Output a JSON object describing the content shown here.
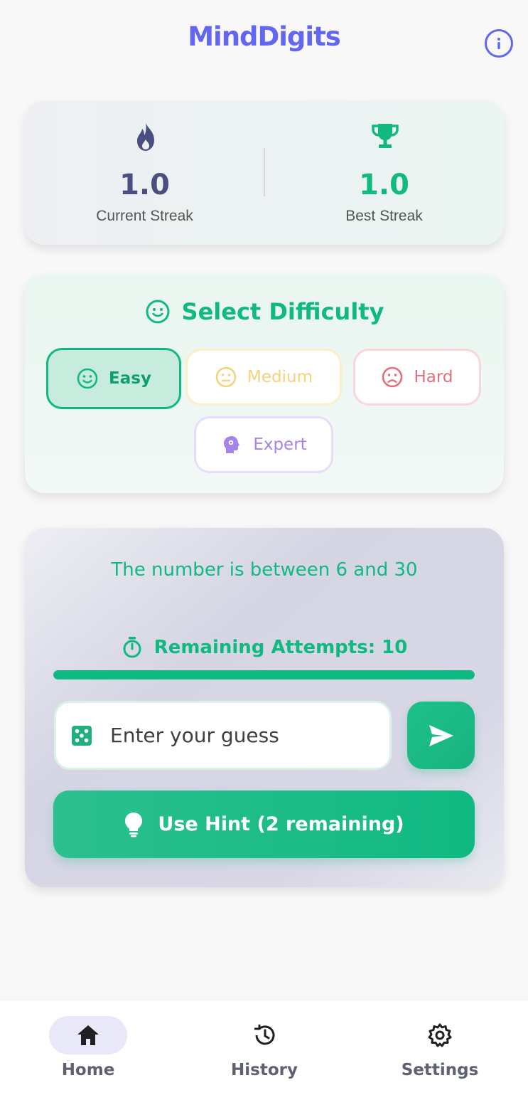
{
  "header": {
    "title": "MindDigits",
    "info_icon": "info-icon"
  },
  "streaks": {
    "current": {
      "value": "1.0",
      "label": "Current Streak",
      "icon": "flame-icon",
      "color": "#4b4e80"
    },
    "best": {
      "value": "1.0",
      "label": "Best Streak",
      "icon": "trophy-icon",
      "color": "#10b981"
    }
  },
  "difficulty": {
    "title": "Select Difficulty",
    "selected": "Easy",
    "options": [
      {
        "label": "Easy",
        "icon": "smile-icon",
        "color": "#10b981"
      },
      {
        "label": "Medium",
        "icon": "neutral-face-icon",
        "color": "#f4d37b"
      },
      {
        "label": "Hard",
        "icon": "sad-face-icon",
        "color": "#e0707f"
      },
      {
        "label": "Expert",
        "icon": "brain-head-icon",
        "color": "#a584ea"
      }
    ]
  },
  "game": {
    "range_text": "The number is between 6 and 30",
    "attempts_label": "Remaining Attempts: 10",
    "attempts_progress": 1.0,
    "guess_placeholder": "Enter your guess",
    "hint_label": "Use Hint (2 remaining)"
  },
  "nav": {
    "active": "Home",
    "items": [
      {
        "label": "Home",
        "icon": "home-icon"
      },
      {
        "label": "History",
        "icon": "history-icon"
      },
      {
        "label": "Settings",
        "icon": "gear-icon"
      }
    ]
  },
  "colors": {
    "primary": "#6366f1",
    "accent": "#10b981"
  }
}
